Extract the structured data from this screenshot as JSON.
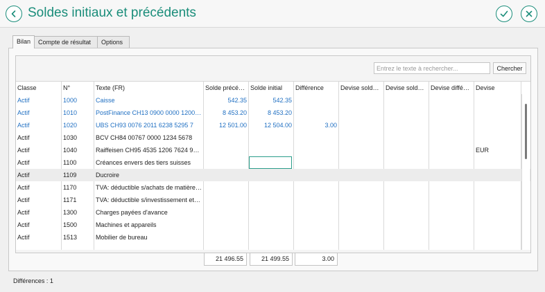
{
  "window": {
    "title": "Soldes initiaux et précédents"
  },
  "tabs": [
    {
      "label": "Bilan",
      "active": true
    },
    {
      "label": "Compte de résultat",
      "active": false
    },
    {
      "label": "Options",
      "active": false
    }
  ],
  "search": {
    "placeholder": "Entrez le texte à rechercher...",
    "value": "",
    "button_label": "Chercher"
  },
  "table": {
    "headers": [
      "Classe",
      "N°",
      "Texte (FR)",
      "Solde précé…",
      "Solde initial",
      "Différence",
      "Devise sold…",
      "Devise sold…",
      "Devise diffé…",
      "Devise"
    ],
    "rows": [
      {
        "classe": "Actif",
        "no": "1000",
        "texte": "Caisse",
        "solde_prec": "542.35",
        "solde_init": "542.35",
        "diff": "",
        "devise": "",
        "highlight": true
      },
      {
        "classe": "Actif",
        "no": "1010",
        "texte": "PostFinance CH13 0900 0000 1200 …",
        "solde_prec": "8 453.20",
        "solde_init": "8 453.20",
        "diff": "",
        "devise": "",
        "highlight": true
      },
      {
        "classe": "Actif",
        "no": "1020",
        "texte": "UBS CH93 0076 2011 6238 5295 7",
        "solde_prec": "12 501.00",
        "solde_init": "12 504.00",
        "diff": "3.00",
        "devise": "",
        "highlight": true
      },
      {
        "classe": "Actif",
        "no": "1030",
        "texte": "BCV CH84 00767 0000 1234 5678",
        "solde_prec": "",
        "solde_init": "",
        "diff": "",
        "devise": "",
        "highlight": false
      },
      {
        "classe": "Actif",
        "no": "1040",
        "texte": "Raiffeisen CH95 4535 1206 7624 98…",
        "solde_prec": "",
        "solde_init": "",
        "diff": "",
        "devise": "EUR",
        "highlight": false
      },
      {
        "classe": "Actif",
        "no": "1100",
        "texte": "Créances envers des tiers suisses",
        "solde_prec": "",
        "solde_init": "",
        "diff": "",
        "devise": "",
        "highlight": false
      },
      {
        "classe": "Actif",
        "no": "1109",
        "texte": "Ducroire",
        "solde_prec": "",
        "solde_init": "",
        "diff": "",
        "devise": "",
        "highlight": false,
        "selected": true
      },
      {
        "classe": "Actif",
        "no": "1170",
        "texte": "TVA: déductible s/achats de matière…",
        "solde_prec": "",
        "solde_init": "",
        "diff": "",
        "devise": "",
        "highlight": false
      },
      {
        "classe": "Actif",
        "no": "1171",
        "texte": "TVA: déductible s/investissement et…",
        "solde_prec": "",
        "solde_init": "",
        "diff": "",
        "devise": "",
        "highlight": false
      },
      {
        "classe": "Actif",
        "no": "1300",
        "texte": "Charges payées d'avance",
        "solde_prec": "",
        "solde_init": "",
        "diff": "",
        "devise": "",
        "highlight": false
      },
      {
        "classe": "Actif",
        "no": "1500",
        "texte": "Machines et appareils",
        "solde_prec": "",
        "solde_init": "",
        "diff": "",
        "devise": "",
        "highlight": false
      },
      {
        "classe": "Actif",
        "no": "1513",
        "texte": "Mobilier de bureau",
        "solde_prec": "",
        "solde_init": "",
        "diff": "",
        "devise": "",
        "highlight": false
      }
    ]
  },
  "totals": {
    "solde_prec": "21 496.55",
    "solde_init": "21 499.55",
    "diff": "3.00"
  },
  "footer": {
    "text": "Différences : 1"
  },
  "colors": {
    "accent": "#1a8d7a",
    "link_blue": "#1f6fc2",
    "focus": "#2a9d8a"
  },
  "icons": {
    "back": "chevron-left-icon",
    "confirm": "check-icon",
    "close": "close-icon"
  }
}
